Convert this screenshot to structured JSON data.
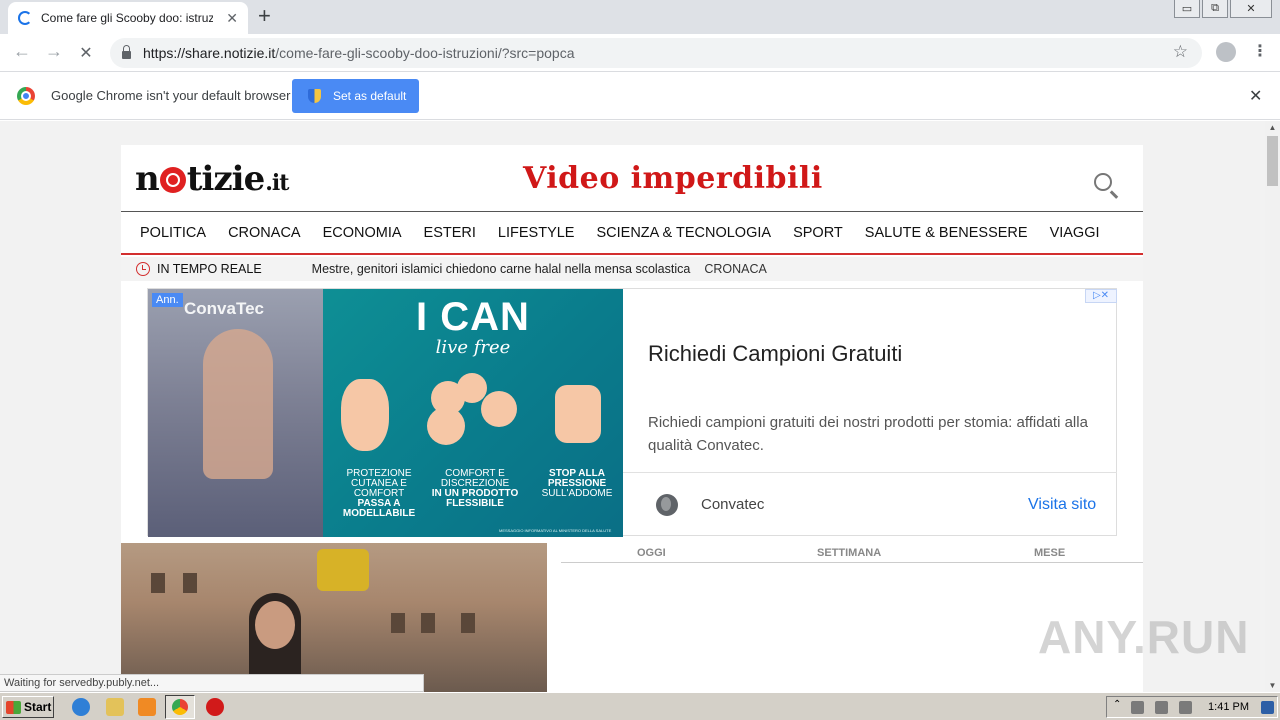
{
  "tab": {
    "title": "Come fare gli Scooby doo: istruzioni",
    "close": "✕",
    "new_tab": "+"
  },
  "window": {
    "minimize": "▭",
    "restore": "⧉",
    "close": "✕"
  },
  "toolbar": {
    "back_icon": "←",
    "forward_icon": "→",
    "reload_icon": "✕",
    "url_host": "https://share.notizie.it",
    "url_rest": "/come-fare-gli-scooby-doo-istruzioni/?src=popca",
    "star_icon": "☆",
    "menu_icon": "⋮"
  },
  "infobar": {
    "message": "Google Chrome isn't your default browser",
    "button": "Set as default",
    "close": "✕"
  },
  "site": {
    "logo_main_a": "n",
    "logo_main_b": "tizie",
    "logo_tld": ".it",
    "headline": "Video imperdibili",
    "nav": [
      "POLITICA",
      "CRONACA",
      "ECONOMIA",
      "ESTERI",
      "LIFESTYLE",
      "SCIENZA & TECNOLOGIA",
      "SPORT",
      "SALUTE & BENESSERE",
      "VIAGGI"
    ],
    "ticker": {
      "label": "IN TEMPO REALE",
      "news": "Mestre, genitori islamici chiedono carne halal nella mensa scolastica",
      "category": "CRONACA"
    }
  },
  "ad": {
    "badge": "Ann.",
    "brand": "ConvaTec",
    "slogan": "I CAN",
    "slogan_sub": "live free",
    "col1": [
      "PROTEZIONE",
      "CUTANEA E",
      "COMFORT",
      "PASSA A",
      "MODELLABILE"
    ],
    "col2": [
      "COMFORT E",
      "DISCREZIONE",
      "IN UN PRODOTTO",
      "FLESSIBILE"
    ],
    "col3": [
      "STOP ALLA",
      "PRESSIONE",
      "SULL'ADDOME"
    ],
    "fine_print": "MESSAGGIO INFORMATIVO AL MINISTERO DELLA SALUTE",
    "adchoices": "▷✕",
    "title": "Richiedi Campioni Gratuiti",
    "description": "Richiedi campioni gratuiti dei nostri prodotti per stomia: affidati alla qualità Convatec.",
    "advertiser": "Convatec",
    "cta": "Visita sito"
  },
  "ranking_tabs": [
    "OGGI",
    "SETTIMANA",
    "MESE"
  ],
  "status_bar": "Waiting for servedby.publy.net...",
  "watermark": "ANY.RUN",
  "taskbar": {
    "start": "Start",
    "time": "1:41 PM"
  }
}
